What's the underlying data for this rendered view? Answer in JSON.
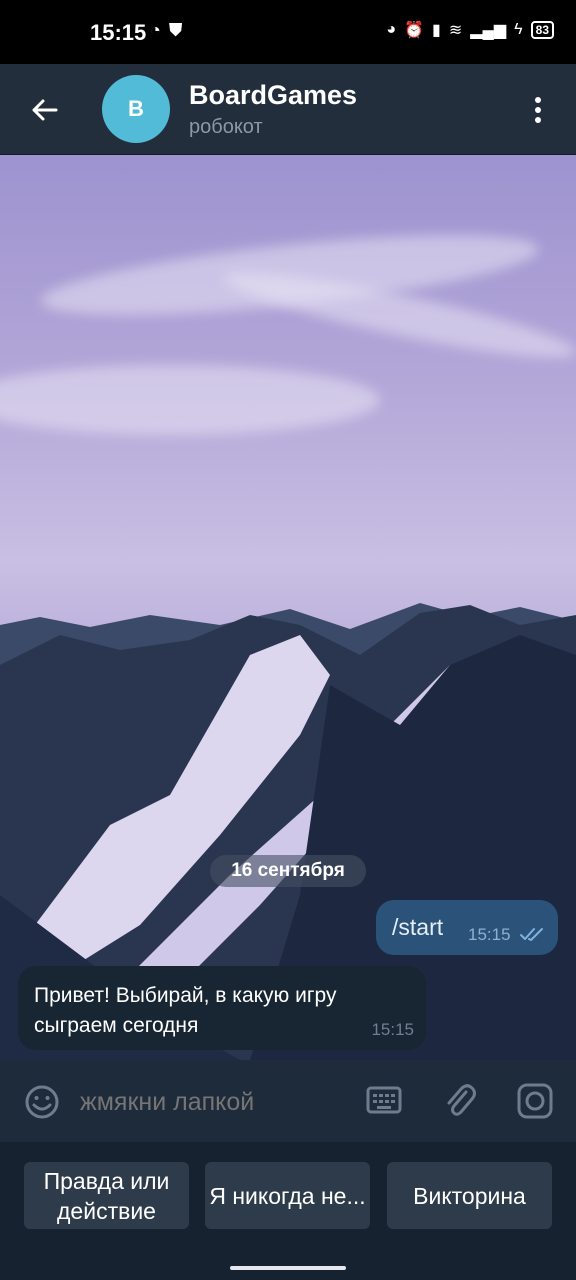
{
  "status": {
    "time": "15:15",
    "battery": "83"
  },
  "header": {
    "avatar_letter": "B",
    "title": "BoardGames",
    "subtitle": "робокот"
  },
  "chat": {
    "date": "16 сентября",
    "messages": [
      {
        "type": "outgoing",
        "text": "/start",
        "time": "15:15"
      },
      {
        "type": "incoming",
        "text": "Привет! Выбирай, в какую игру сыграем сегодня",
        "time": "15:15"
      }
    ]
  },
  "input": {
    "placeholder": "жмякни лапкой"
  },
  "keyboard": {
    "buttons": [
      "Правда или действие",
      "Я никогда не...",
      "Викторина"
    ]
  },
  "colors": {
    "accent": "#52bcd8",
    "outgoing_bubble": "#2b5278",
    "incoming_bubble": "#182533",
    "header": "#232e3c"
  },
  "icons": [
    "back-arrow-icon",
    "more-vert-icon",
    "emoji-icon",
    "keyboard-icon",
    "attach-icon",
    "camera-icon",
    "double-check-icon"
  ]
}
